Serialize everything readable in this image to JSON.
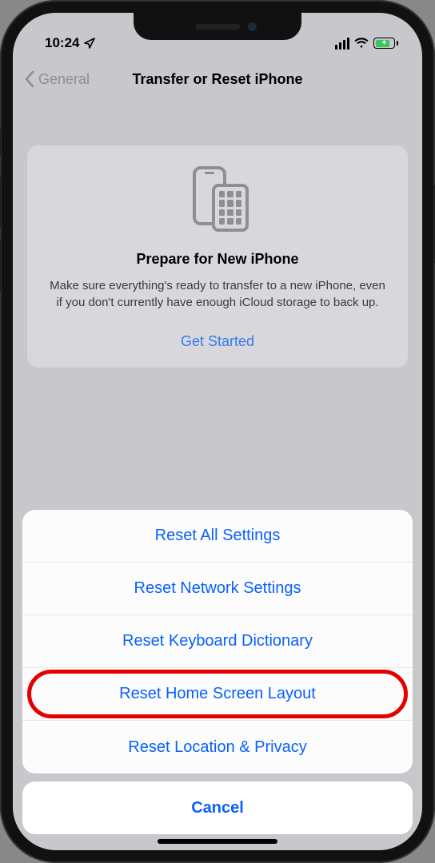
{
  "status": {
    "time": "10:24"
  },
  "nav": {
    "back_label": "General",
    "title": "Transfer or Reset iPhone"
  },
  "prepare_card": {
    "title": "Prepare for New iPhone",
    "description": "Make sure everything's ready to transfer to a new iPhone, even if you don't currently have enough iCloud storage to back up.",
    "cta": "Get Started"
  },
  "action_sheet": {
    "items": [
      {
        "label": "Reset All Settings"
      },
      {
        "label": "Reset Network Settings"
      },
      {
        "label": "Reset Keyboard Dictionary"
      },
      {
        "label": "Reset Home Screen Layout"
      },
      {
        "label": "Reset Location & Privacy"
      }
    ],
    "cancel": "Cancel",
    "highlighted_index": 3
  }
}
